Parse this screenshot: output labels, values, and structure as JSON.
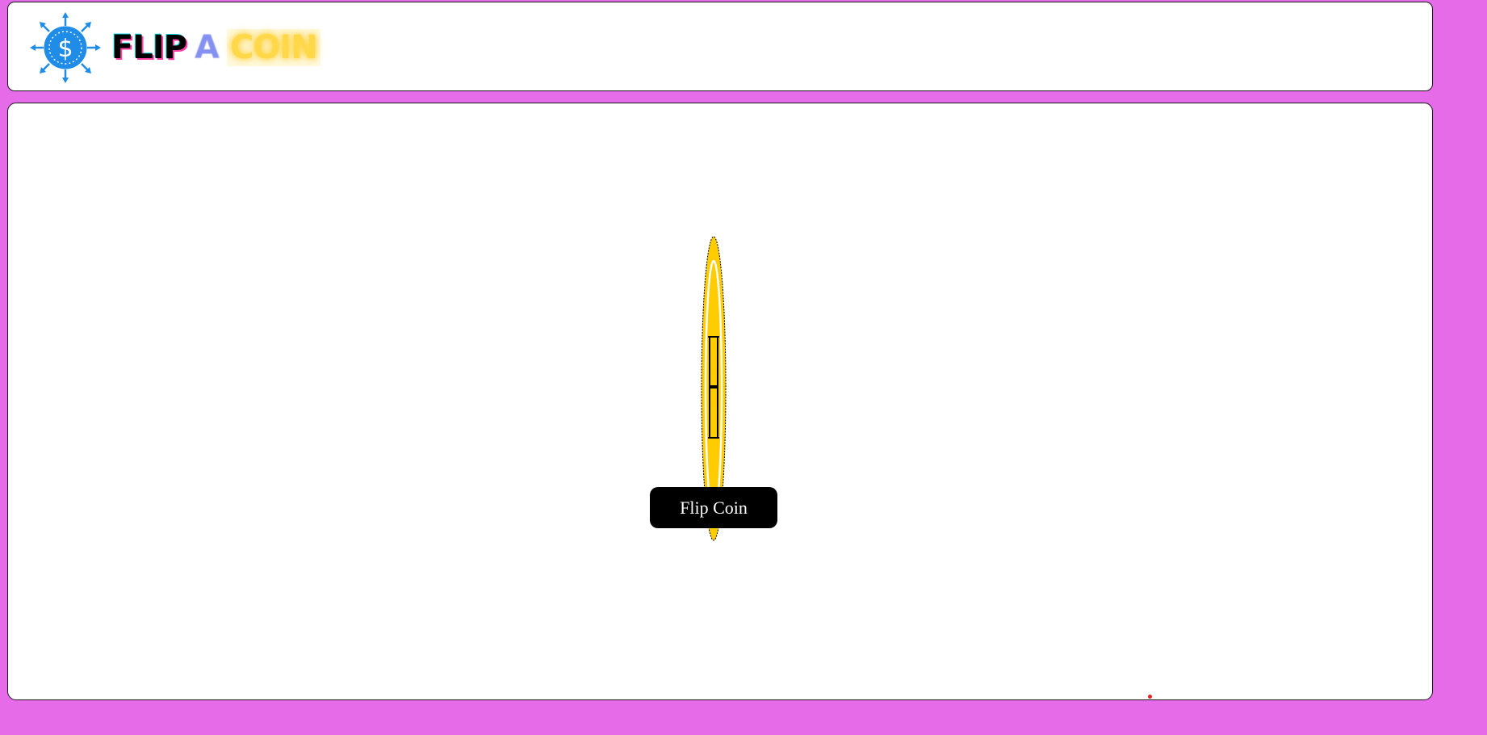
{
  "header": {
    "logo": {
      "word_1": "FLIP",
      "word_2": "A",
      "word_3": "COIN",
      "icon": "dollar-coin-arrows-icon",
      "icon_color": "#1f8ce8"
    }
  },
  "main": {
    "coin": {
      "icon": "coin-icon",
      "face_color": "#ffcc00",
      "edge_color": "#000000"
    },
    "flip_button_label": "Flip Coin"
  },
  "colors": {
    "page_background": "#e56be8",
    "panel_background": "#ffffff",
    "button_background": "#000000",
    "button_text": "#ffffff"
  }
}
